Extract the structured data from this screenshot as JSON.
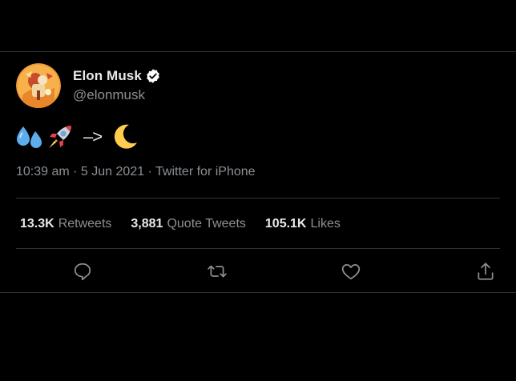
{
  "tweet": {
    "author": {
      "display_name": "Elon Musk",
      "handle": "@elonmusk",
      "verified": true
    },
    "text": {
      "emoji_1": "sweat-droplets-emoji",
      "emoji_2": "rocket-emoji",
      "arrow": "–>",
      "emoji_3": "crescent-moon-emoji"
    },
    "timestamp": "10:39 am · 5 Jun 2021 · Twitter for iPhone",
    "stats": {
      "retweets_count": "13.3K",
      "retweets_label": "Retweets",
      "quotes_count": "3,881",
      "quotes_label": "Quote Tweets",
      "likes_count": "105.1K",
      "likes_label": "Likes"
    }
  },
  "actions": [
    "reply-icon",
    "retweet-icon",
    "like-icon",
    "share-icon"
  ],
  "colors": {
    "background": "#000000",
    "primary_text": "#e7e9ea",
    "secondary_text": "#8b9095",
    "divider": "#2f3336",
    "verified": "#ffffff"
  }
}
